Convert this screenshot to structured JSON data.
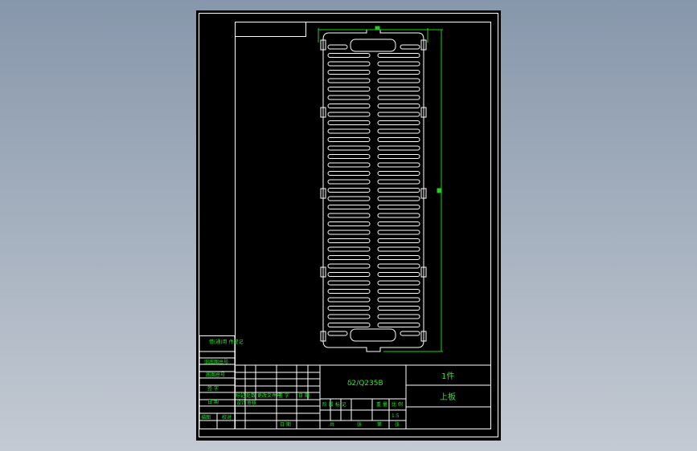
{
  "drawing": {
    "material": "δ2/Q235B",
    "quantity": "1件",
    "part_name": "上板",
    "scale": "1:5",
    "colors": {
      "background": "#000000",
      "frame": "#ffffff",
      "text": "#22ee22",
      "dimension": "#22cc22",
      "part": "#ffffff"
    }
  },
  "title_block": {
    "left": [
      "借(通)用 件登记",
      "旧底图总号",
      "底图总号",
      "签 字",
      "日 期",
      "描图",
      "校对"
    ],
    "change_headers": [
      "标记",
      "处数",
      "更改文件号",
      "签 字",
      "日 期"
    ],
    "sign_rows": [
      "设计",
      "审核",
      "日 期"
    ],
    "stage_headers": [
      "阶 段 标 记",
      "重 量",
      "比 例"
    ],
    "sheet_info": [
      "共",
      "张",
      "第",
      "张"
    ]
  }
}
